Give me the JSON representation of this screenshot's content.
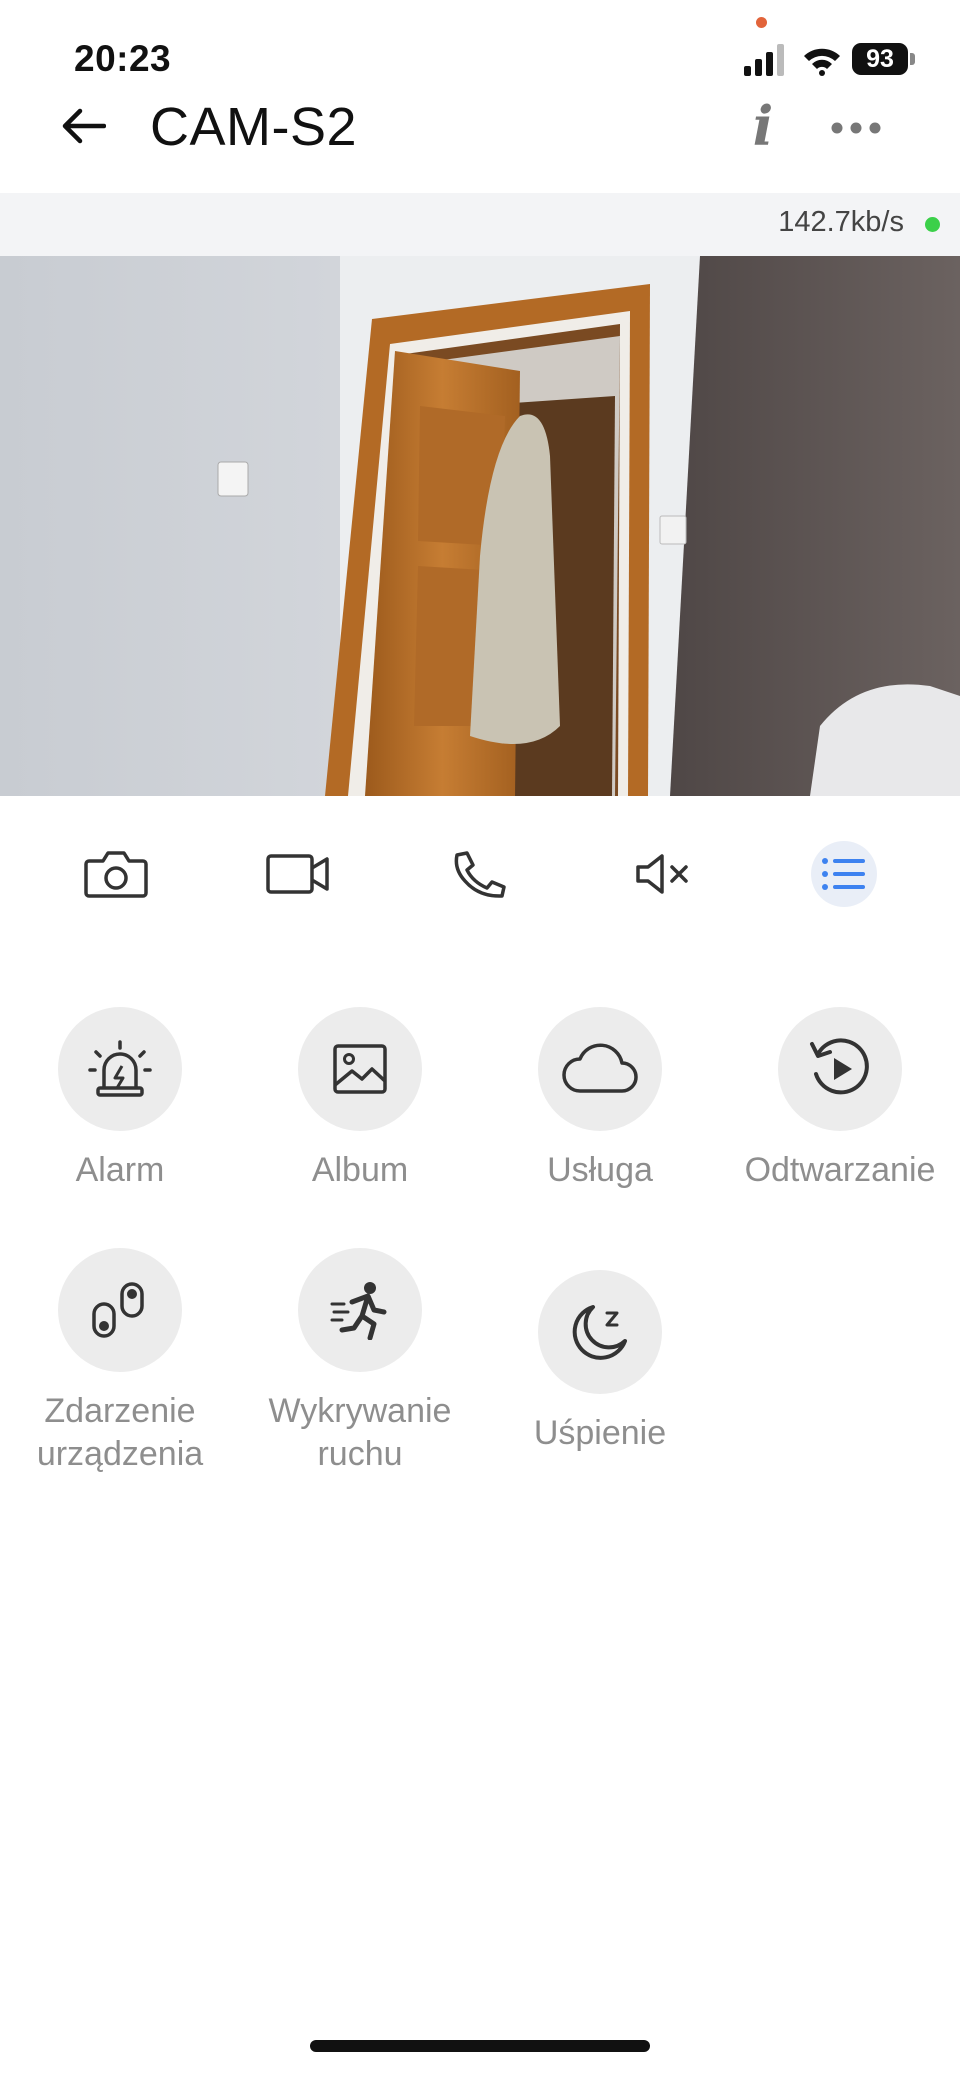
{
  "status_bar": {
    "time": "20:23",
    "battery": "93"
  },
  "header": {
    "title": "CAM-S2",
    "info_icon": "info-icon",
    "more_icon": "more-icon",
    "back_icon": "arrow-left-icon"
  },
  "stream": {
    "bitrate": "142.7kb/s",
    "status_color": "#3bd04a"
  },
  "toolbar": [
    {
      "name": "screenshot",
      "icon": "camera-icon"
    },
    {
      "name": "record",
      "icon": "video-camera-icon"
    },
    {
      "name": "talk",
      "icon": "phone-icon"
    },
    {
      "name": "mute",
      "icon": "speaker-muted-icon"
    },
    {
      "name": "menu",
      "icon": "list-icon",
      "active_color": "#3d82f0"
    }
  ],
  "features": [
    {
      "label": "Alarm",
      "icon": "alarm-siren-icon"
    },
    {
      "label": "Album",
      "icon": "image-icon"
    },
    {
      "label": "Usługa",
      "icon": "cloud-icon"
    },
    {
      "label": "Odtwarzanie",
      "icon": "playback-icon"
    },
    {
      "label": "Zdarzenie urządzenia",
      "icon": "device-event-icon"
    },
    {
      "label": "Wykrywanie ruchu",
      "icon": "motion-detection-icon"
    },
    {
      "label": "Uśpienie",
      "icon": "sleep-moon-icon"
    }
  ]
}
